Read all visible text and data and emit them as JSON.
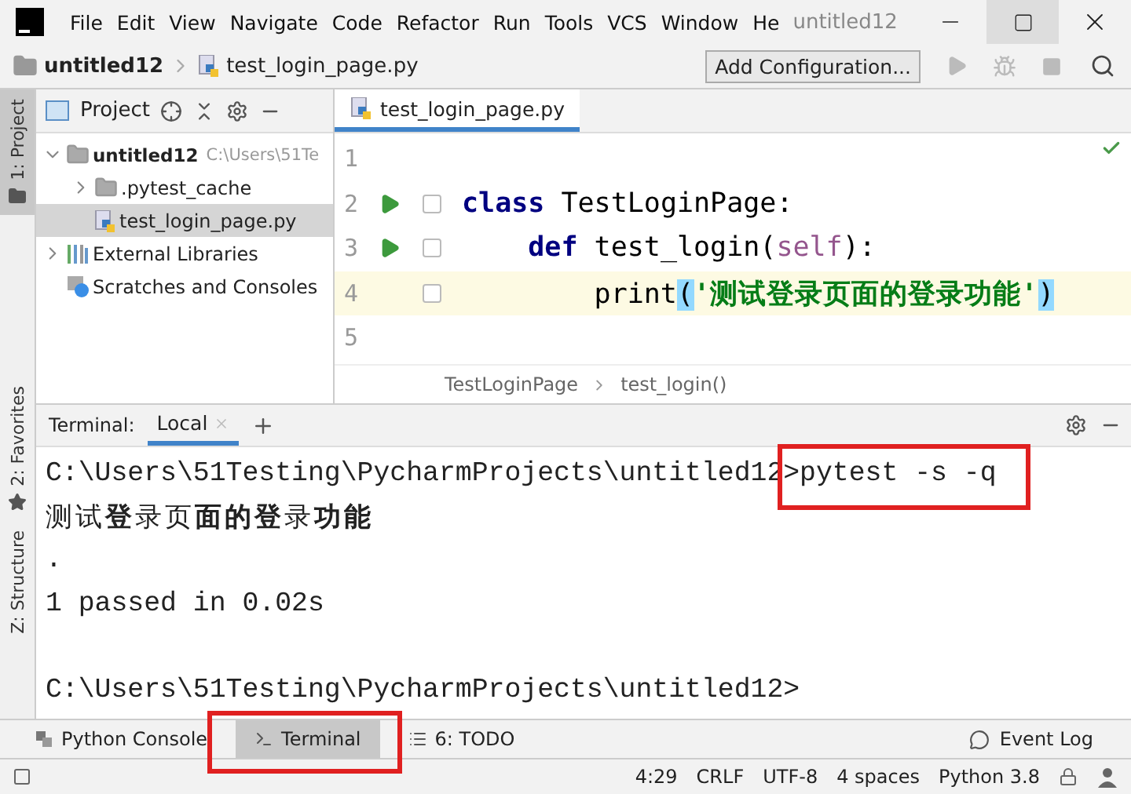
{
  "window": {
    "title": "untitled12",
    "menu": [
      "File",
      "Edit",
      "View",
      "Navigate",
      "Code",
      "Refactor",
      "Run",
      "Tools",
      "VCS",
      "Window",
      "He"
    ]
  },
  "navbar": {
    "project": "untitled12",
    "file": "test_login_page.py",
    "config_button": "Add Configuration..."
  },
  "side_stripe": {
    "top": "1: Project",
    "bottom": [
      "2: Favorites",
      "Z: Structure"
    ]
  },
  "project_panel": {
    "title": "Project",
    "tree": [
      {
        "label": "untitled12",
        "kind": "folder",
        "path": "C:\\Users\\51Te",
        "expanded": true,
        "selected": false,
        "children": [
          {
            "label": ".pytest_cache",
            "kind": "folder",
            "expanded": false,
            "selected": false
          },
          {
            "label": "test_login_page.py",
            "kind": "python",
            "selected": true
          }
        ]
      },
      {
        "label": "External Libraries",
        "kind": "library",
        "expanded": false,
        "selected": false
      },
      {
        "label": "Scratches and Consoles",
        "kind": "scratch",
        "selected": false
      }
    ]
  },
  "editor": {
    "tab": {
      "label": "test_login_page.py",
      "selected": true
    },
    "lines": [
      {
        "number": "1",
        "run": false,
        "fold": false,
        "current": false
      },
      {
        "number": "2",
        "run": true,
        "fold": true,
        "current": false,
        "tokens": [
          {
            "kind": "keyword",
            "text": "class"
          },
          {
            "kind": "plain",
            "text": " TestLoginPage:"
          }
        ]
      },
      {
        "number": "3",
        "run": true,
        "fold": true,
        "current": false,
        "tokens": [
          {
            "kind": "keyword",
            "text": "    def"
          },
          {
            "kind": "plain",
            "text": " test_login("
          },
          {
            "kind": "self",
            "text": "self"
          },
          {
            "kind": "plain",
            "text": "):"
          }
        ]
      },
      {
        "number": "4",
        "run": false,
        "fold": true,
        "current": true,
        "tokens": [
          {
            "kind": "plain",
            "text": "        print"
          },
          {
            "kind": "brace",
            "text": "("
          },
          {
            "kind": "string",
            "text": "'测试登录页面的登录功能'"
          },
          {
            "kind": "brace",
            "text": ")"
          }
        ]
      },
      {
        "number": "5",
        "run": false,
        "fold": false,
        "current": false
      }
    ],
    "breadcrumbs": [
      "TestLoginPage",
      "test_login()"
    ]
  },
  "terminal": {
    "label": "Terminal:",
    "tabs": [
      {
        "label": "Local",
        "selected": true
      }
    ],
    "lines": [
      {
        "kind": "command",
        "prompt": "C:\\Users\\51Testing\\PycharmProjects\\untitled12",
        "command": ">pytest -s -q",
        "highlighted": true
      },
      {
        "kind": "output",
        "text": "测试**登**录页**面的登**录**功能**"
      },
      {
        "kind": "output",
        "text": "."
      },
      {
        "kind": "output",
        "text": "1 passed in 0.02s"
      },
      {
        "kind": "blank"
      },
      {
        "kind": "prompt",
        "prompt": "C:\\Users\\51Testing\\PycharmProjects\\untitled12>"
      }
    ]
  },
  "tool_tabs": [
    {
      "label": "Python Console",
      "kind": "python",
      "selected": false,
      "highlighted": false
    },
    {
      "label": "Terminal",
      "kind": "terminal",
      "selected": true,
      "highlighted": true
    },
    {
      "label": "6: TODO",
      "kind": "todo",
      "selected": false,
      "highlighted": false
    }
  ],
  "event_log": "Event Log",
  "status_bar": [
    "4:29",
    "CRLF",
    "UTF-8",
    "4 spaces",
    "Python 3.8"
  ]
}
